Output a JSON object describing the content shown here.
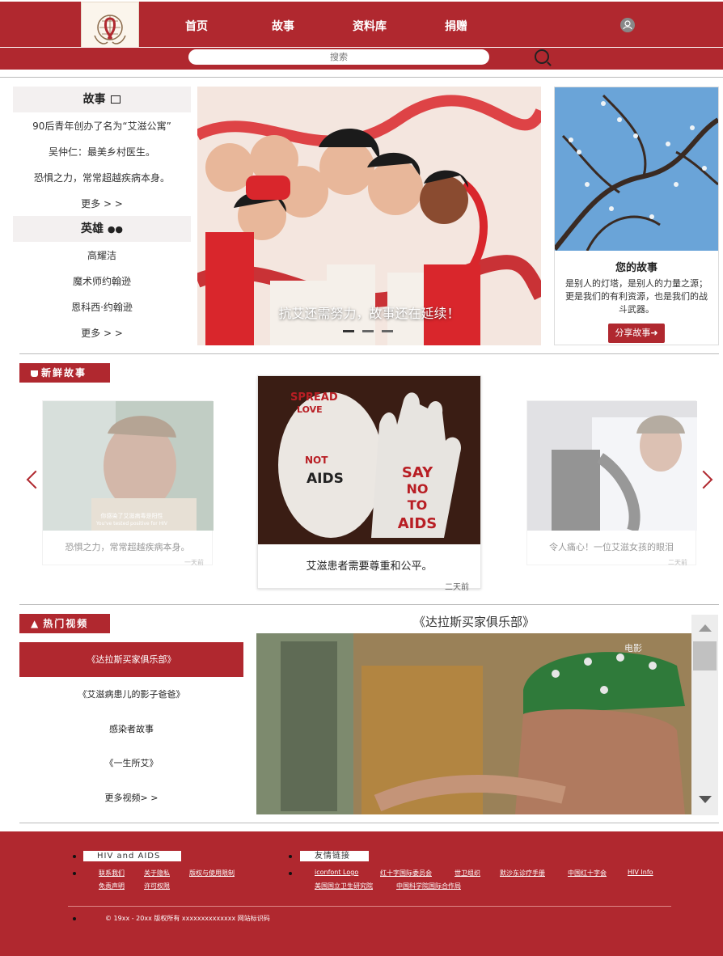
{
  "header": {
    "nav": [
      "首页",
      "故事",
      "资料库",
      "捐赠"
    ],
    "search_placeholder": "搜索"
  },
  "sidebar": {
    "story_heading": "故事",
    "stories": [
      "90后青年创办了名为“艾滋公寓”",
      "吴仲仁：最美乡村医生。",
      "恐惧之力，常常超越疾病本身。"
    ],
    "stories_more": "更多 > >",
    "hero_heading": "英雄",
    "heroes": [
      "高耀洁",
      "魔术师约翰逊",
      "恩科西·约翰逊"
    ],
    "heroes_more": "更多 > >"
  },
  "hero": {
    "caption": "抗艾还需努力，故事还在延续！"
  },
  "story_card": {
    "title": "您的故事",
    "text": "是别人的灯塔，是别人的力量之源；更是我们的有利资源，也是我们的战斗武器。",
    "button": "分享故事"
  },
  "fresh": {
    "tag": "新鲜故事",
    "cards": [
      {
        "text": "恐惧之力，常常超越疾病本身。",
        "time": "一天前",
        "subtitle_cn": "你感染了艾滋病毒是阳性",
        "subtitle_en": "You've tested positive for HIV"
      },
      {
        "text": "艾滋患者需要尊重和公平。",
        "time": "二天前",
        "paint_1": "SPREAD",
        "paint_2": "LOVE",
        "paint_3": "NOT",
        "paint_4": "AIDS",
        "paint_5": "SAY",
        "paint_6": "NO",
        "paint_7": "TO",
        "paint_8": "AIDS"
      },
      {
        "text": "令人痛心！一位艾滋女孩的眼泪",
        "time": "二天前"
      }
    ]
  },
  "video": {
    "tag": "热门视频",
    "title": "《达拉斯买家俱乐部》",
    "items": [
      "《达拉斯买家俱乐部》",
      "《艾滋病患儿的影子爸爸》",
      "感染者故事",
      "《一生所艾》",
      "更多视频> >"
    ],
    "watermark": "电影"
  },
  "footer": {
    "col1_head": "HIV  and  AIDS",
    "col1_links": [
      "联系我们",
      "关于隐私",
      "版权与使用限制",
      "免责声明",
      "许可权限"
    ],
    "col2_head": "友情链接",
    "col2_links": [
      "iconfont Logo",
      "红十字国际委员会",
      "世卫组织",
      "默沙东诊疗手册",
      "中国红十字会",
      "HIV Info",
      "美国国立卫生研究院",
      "中国科学院国际合作局"
    ],
    "copyright": "© 19xx - 20xx 版权所有 xxxxxxxxxxxxxx 网站标识码"
  },
  "colors": {
    "brand": "#b0282f"
  }
}
